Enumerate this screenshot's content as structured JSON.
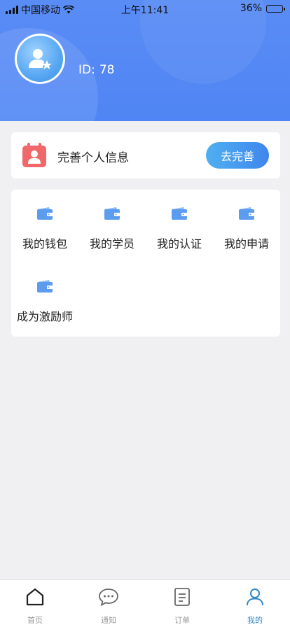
{
  "status_bar": {
    "carrier": "中国移动",
    "time": "上午11:41",
    "battery": "36%",
    "battery_level": 0.36
  },
  "header": {
    "id_prefix": "ID:",
    "id_value": "78"
  },
  "profile_card": {
    "title": "完善个人信息",
    "button_label": "去完善"
  },
  "menu": {
    "items": [
      {
        "label": "我的钱包",
        "icon": "wallet-icon"
      },
      {
        "label": "我的学员",
        "icon": "wallet-icon"
      },
      {
        "label": "我的认证",
        "icon": "wallet-icon"
      },
      {
        "label": "我的申请",
        "icon": "wallet-icon"
      },
      {
        "label": "成为激励师",
        "icon": "wallet-icon"
      }
    ]
  },
  "tabbar": {
    "tabs": [
      {
        "label": "首页",
        "icon": "home-icon"
      },
      {
        "label": "通知",
        "icon": "chat-bubble-icon"
      },
      {
        "label": "订单",
        "icon": "document-icon"
      },
      {
        "label": "我的",
        "icon": "user-icon"
      }
    ],
    "active_index": 3
  },
  "colors": {
    "header": "#5a8cf5",
    "accent": "#3f86ee",
    "active_tab": "#2e86c8",
    "calendar": "#f0686a",
    "wallet": "#5b9cf0"
  }
}
